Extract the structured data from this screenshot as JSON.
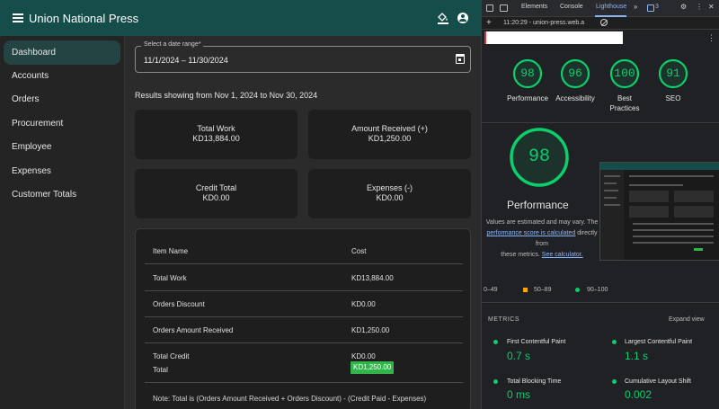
{
  "app": {
    "title": "Union National Press",
    "nav": [
      "Dashboard",
      "Accounts",
      "Orders",
      "Procurement",
      "Employee",
      "Expenses",
      "Customer Totals"
    ],
    "date_range": {
      "label": "Select a date range*",
      "value": "11/1/2024  – 11/30/2024"
    },
    "results_text": "Results showing from Nov 1, 2024 to Nov 30, 2024",
    "cards": [
      {
        "title": "Total Work",
        "value": "KD13,884.00"
      },
      {
        "title": "Amount Received (+)",
        "value": "KD1,250.00"
      },
      {
        "title": "Credit Total",
        "value": "KD0.00"
      },
      {
        "title": "Expenses (-)",
        "value": "KD0.00"
      }
    ],
    "table": {
      "headers": [
        "Item Name",
        "Cost"
      ],
      "rows": [
        {
          "name": "Total Work",
          "cost": "KD13,884.00"
        },
        {
          "name": "Orders Discount",
          "cost": "KD0.00"
        },
        {
          "name": "Orders Amount Received",
          "cost": "KD1,250.00"
        },
        {
          "name": "Total Credit",
          "cost": "KD0.00"
        },
        {
          "name": "Total",
          "cost": "KD1,250.00"
        }
      ],
      "note": "Note: Total is (Orders Amount Received + Orders Discount) - (Credit Paid - Expenses)"
    }
  },
  "devtools": {
    "tabs": [
      "Elements",
      "Console",
      "Lighthouse"
    ],
    "more": "»",
    "badge": "3",
    "report_time": "11:20:29 - union-press.web.a",
    "scores": [
      {
        "value": "98",
        "label": "Performance"
      },
      {
        "value": "96",
        "label": "Accessibility"
      },
      {
        "value": "100",
        "label": "Best Practices"
      },
      {
        "value": "91",
        "label": "SEO"
      }
    ],
    "perf_score": "98",
    "perf_title": "Performance",
    "values_note_1": "Values are estimated and may vary. The",
    "values_note_link": "performance score is calculated",
    "values_note_2": " directly from",
    "values_note_3": "these metrics.",
    "calculator_link": "See calculator.",
    "legend": [
      "0–49",
      "50–89",
      "90–100"
    ],
    "metrics_heading": "METRICS",
    "expand": "Expand view",
    "metrics": [
      {
        "name": "First Contentful Paint",
        "value": "0.7 s"
      },
      {
        "name": "Largest Contentful Paint",
        "value": "1.1 s"
      },
      {
        "name": "Total Blocking Time",
        "value": "0 ms"
      },
      {
        "name": "Cumulative Layout Shift",
        "value": "0.002"
      }
    ],
    "thumbnail": {
      "title": "Union National Press"
    }
  },
  "colors": {
    "appbar": "#154d4a",
    "active_nav": "#234443",
    "good": "#0cce6b",
    "badge": "#31b54a",
    "link": "#8ab4f8"
  }
}
